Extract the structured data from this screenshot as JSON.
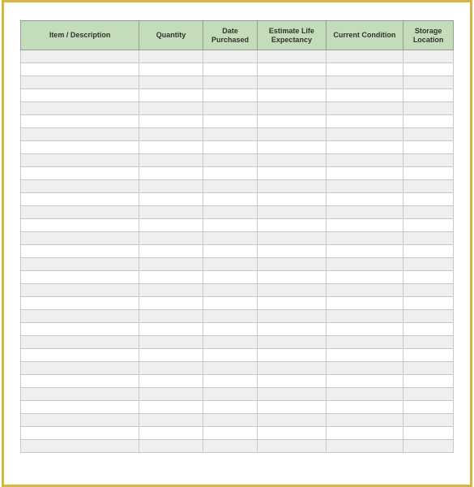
{
  "headers": {
    "item_description": "Item / Description",
    "quantity": "Quantity",
    "date_purchased": "Date Purchased",
    "estimate_life": "Estimate Life Expectancy",
    "current_condition": "Current Condition",
    "storage_location": "Storage Location"
  },
  "row_count": 31
}
